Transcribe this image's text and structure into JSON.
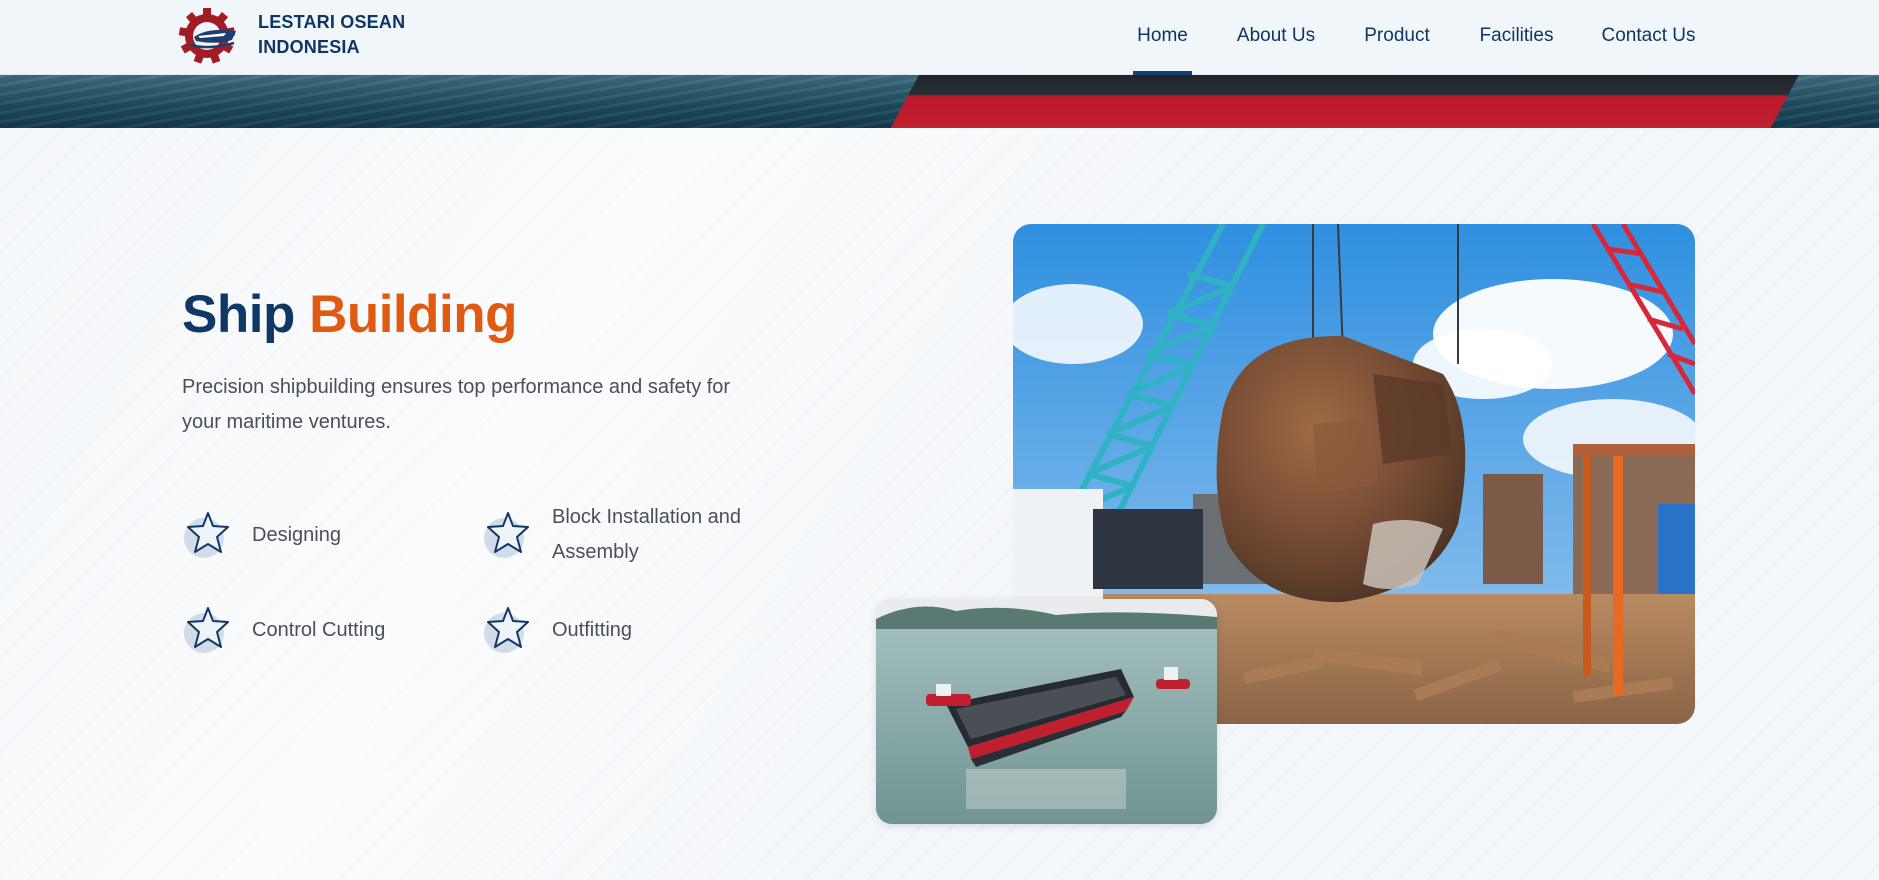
{
  "brand": {
    "name_line1": "LESTARI OSEAN",
    "name_line2": "INDONESIA",
    "logo_icon": "gear-ship-logo",
    "colors": {
      "primary": "#0f3563",
      "accent": "#e05a12",
      "logo_red": "#a31c24"
    }
  },
  "nav": {
    "items": [
      {
        "label": "Home",
        "active": true
      },
      {
        "label": "About Us",
        "active": false
      },
      {
        "label": "Product",
        "active": false
      },
      {
        "label": "Facilities",
        "active": false
      },
      {
        "label": "Contact Us",
        "active": false
      }
    ]
  },
  "section": {
    "title_plain": "Ship",
    "title_accent": "Building",
    "description": "Precision shipbuilding ensures top performance and safety for your maritime ventures.",
    "features": [
      {
        "label": "Designing",
        "icon": "star-icon"
      },
      {
        "label": "Block Installation and Assembly",
        "icon": "star-icon"
      },
      {
        "label": "Control Cutting",
        "icon": "star-icon"
      },
      {
        "label": "Outfitting",
        "icon": "star-icon"
      }
    ]
  },
  "images": {
    "main": "shipyard-crane-lifting-hull-block-photo",
    "secondary": "barge-on-water-photo"
  }
}
